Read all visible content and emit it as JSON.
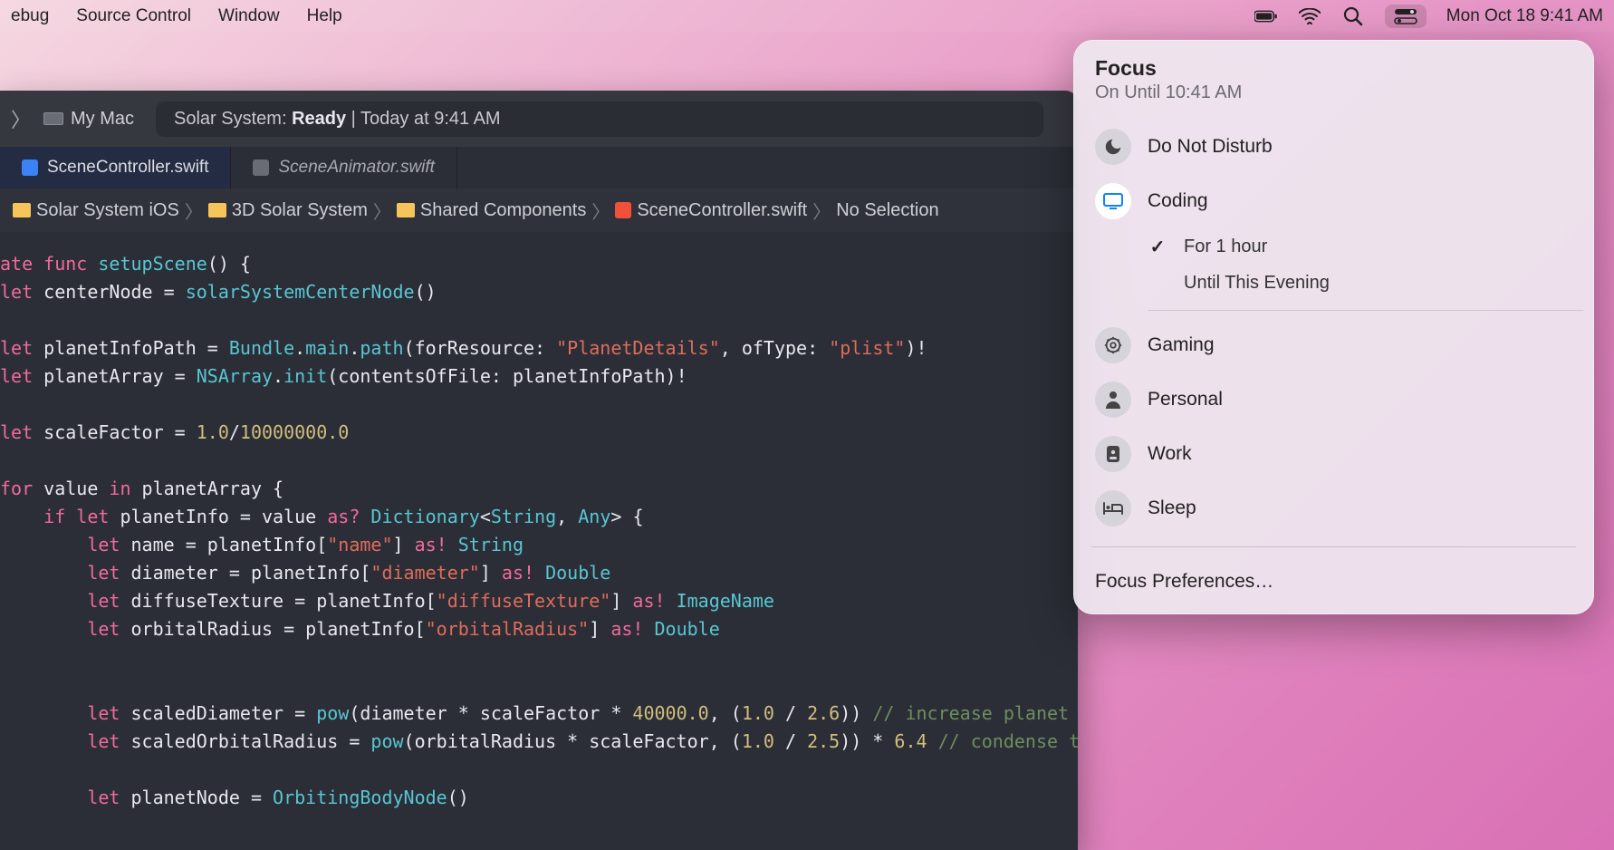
{
  "menubar": {
    "items": [
      "ebug",
      "Source Control",
      "Window",
      "Help"
    ],
    "datetime": "Mon Oct 18  9:41 AM"
  },
  "xcode": {
    "scheme_target": "My Mac",
    "status_prefix": "Solar System: ",
    "status_state": "Ready",
    "status_suffix": " | Today at 9:41 AM",
    "tabs": [
      {
        "label": "SceneController.swift",
        "active": true
      },
      {
        "label": "SceneAnimator.swift",
        "active": false
      }
    ],
    "breadcrumb": [
      {
        "label": "Solar System iOS",
        "icon": "folder"
      },
      {
        "label": "3D Solar System",
        "icon": "folder"
      },
      {
        "label": "Shared Components",
        "icon": "folder"
      },
      {
        "label": "SceneController.swift",
        "icon": "swift"
      },
      {
        "label": "No Selection",
        "icon": ""
      }
    ]
  },
  "code": {
    "l1a": "ate ",
    "l1b": "func ",
    "l1c": "setupScene",
    "l1d": "() {",
    "l2a": "let ",
    "l2b": "centerNode = ",
    "l2c": "solarSystemCenterNode",
    "l2d": "()",
    "l3a": "let ",
    "l3b": "planetInfoPath = ",
    "l3c": "Bundle",
    "l3d": ".",
    "l3e": "main",
    "l3f": ".",
    "l3g": "path",
    "l3h": "(forResource: ",
    "l3i": "\"PlanetDetails\"",
    "l3j": ", ofType: ",
    "l3k": "\"plist\"",
    "l3l": ")!",
    "l4a": "let ",
    "l4b": "planetArray = ",
    "l4c": "NSArray",
    "l4d": ".",
    "l4e": "init",
    "l4f": "(contentsOfFile: planetInfoPath)!",
    "l5a": "let ",
    "l5b": "scaleFactor = ",
    "l5c": "1.0",
    "l5d": "/",
    "l5e": "10000000.0",
    "l6a": "for ",
    "l6b": "value ",
    "l6c": "in ",
    "l6d": "planetArray {",
    "l7a": "    if ",
    "l7b": "let ",
    "l7c": "planetInfo = value ",
    "l7d": "as? ",
    "l7e": "Dictionary",
    "l7f": "<",
    "l7g": "String",
    "l7h": ", ",
    "l7i": "Any",
    "l7j": "> {",
    "l8a": "        let ",
    "l8b": "name = planetInfo[",
    "l8c": "\"name\"",
    "l8d": "] ",
    "l8e": "as! ",
    "l8f": "String",
    "l9a": "        let ",
    "l9b": "diameter = planetInfo[",
    "l9c": "\"diameter\"",
    "l9d": "] ",
    "l9e": "as! ",
    "l9f": "Double",
    "l10a": "        let ",
    "l10b": "diffuseTexture = planetInfo[",
    "l10c": "\"diffuseTexture\"",
    "l10d": "] ",
    "l10e": "as! ",
    "l10f": "ImageName",
    "l11a": "        let ",
    "l11b": "orbitalRadius = planetInfo[",
    "l11c": "\"orbitalRadius\"",
    "l11d": "] ",
    "l11e": "as! ",
    "l11f": "Double",
    "l12a": "        let ",
    "l12b": "scaledDiameter = ",
    "l12c": "pow",
    "l12d": "(diameter * scaleFactor * ",
    "l12e": "40000.0",
    "l12f": ", (",
    "l12g": "1.0",
    "l12h": " / ",
    "l12i": "2.6",
    "l12j": ")) ",
    "l12k": "// increase planet size",
    "l13a": "        let ",
    "l13b": "scaledOrbitalRadius = ",
    "l13c": "pow",
    "l13d": "(orbitalRadius * scaleFactor, (",
    "l13e": "1.0",
    "l13f": " / ",
    "l13g": "2.5",
    "l13h": ")) * ",
    "l13i": "6.4",
    "l13j": " ",
    "l13k": "// condense the space",
    "l14a": "        let ",
    "l14b": "planetNode = ",
    "l14c": "OrbitingBodyNode",
    "l14d": "()"
  },
  "focus": {
    "title": "Focus",
    "subtitle": "On Until 10:41 AM",
    "modes": [
      {
        "label": "Do Not Disturb",
        "icon": "moon",
        "active": false
      },
      {
        "label": "Coding",
        "icon": "display",
        "active": true
      },
      {
        "label": "Gaming",
        "icon": "gear",
        "active": false
      },
      {
        "label": "Personal",
        "icon": "person",
        "active": false
      },
      {
        "label": "Work",
        "icon": "badge",
        "active": false
      },
      {
        "label": "Sleep",
        "icon": "bed",
        "active": false
      }
    ],
    "sub_options": [
      {
        "label": "For 1 hour",
        "checked": true
      },
      {
        "label": "Until This Evening",
        "checked": false
      }
    ],
    "prefs": "Focus Preferences…"
  }
}
